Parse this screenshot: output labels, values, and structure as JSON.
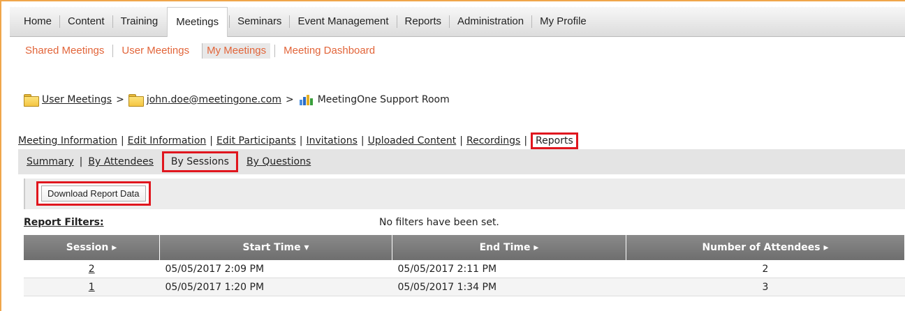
{
  "topnav": [
    "Home",
    "Content",
    "Training",
    "Meetings",
    "Seminars",
    "Event Management",
    "Reports",
    "Administration",
    "My Profile"
  ],
  "topnav_active": "Meetings",
  "subnav": [
    "Shared Meetings",
    "User Meetings",
    "My Meetings",
    "Meeting Dashboard"
  ],
  "subnav_active": "My Meetings",
  "breadcrumb": {
    "folder1": "User Meetings",
    "sep": ">",
    "folder2": "john.doe@meetingone.com",
    "room": "MeetingOne Support Room"
  },
  "meeting_links": [
    "Meeting Information",
    "Edit Information",
    "Edit Participants",
    "Invitations",
    "Uploaded Content",
    "Recordings",
    "Reports"
  ],
  "report_tabs": [
    "Summary",
    "By Attendees",
    "By Sessions",
    "By Questions"
  ],
  "download_button": "Download Report Data",
  "filters": {
    "label": "Report Filters:",
    "text": "No filters have been set."
  },
  "table": {
    "headers": [
      "Session ▸",
      "Start Time ▾",
      "End Time ▸",
      "Number of Attendees ▸"
    ],
    "rows": [
      {
        "session": "2",
        "start": "05/05/2017 2:09 PM",
        "end": "05/05/2017 2:11 PM",
        "attendees": "2"
      },
      {
        "session": "1",
        "start": "05/05/2017 1:20 PM",
        "end": "05/05/2017 1:34 PM",
        "attendees": "3"
      }
    ]
  },
  "colors": {
    "accent": "#e2653a",
    "highlight": "#e0161e",
    "frame": "#f0a64a"
  }
}
